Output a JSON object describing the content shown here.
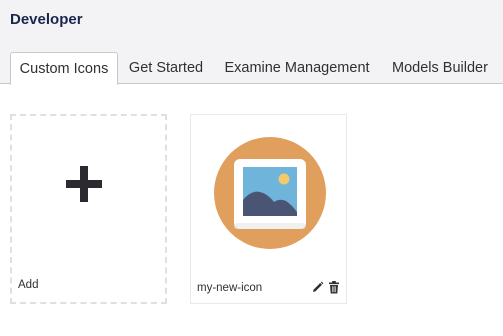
{
  "header": {
    "title": "Developer"
  },
  "tabs": [
    {
      "label": "Custom Icons",
      "active": true
    },
    {
      "label": "Get Started",
      "active": false
    },
    {
      "label": "Examine Management",
      "active": false
    },
    {
      "label": "Models Builder",
      "active": false
    }
  ],
  "cards": {
    "add": {
      "label": "Add",
      "icon": "plus-icon"
    },
    "items": [
      {
        "label": "my-new-icon",
        "icon": "image-icon",
        "actions": [
          "pencil-icon",
          "trash-icon"
        ]
      }
    ]
  },
  "colors": {
    "header_bg": "#f3f3f5",
    "title_color": "#1b264f",
    "icon_circle": "#e19f5e",
    "image_sky": "#6fb4da",
    "image_mountain": "#4a5573",
    "image_sun": "#f1cb6b"
  }
}
